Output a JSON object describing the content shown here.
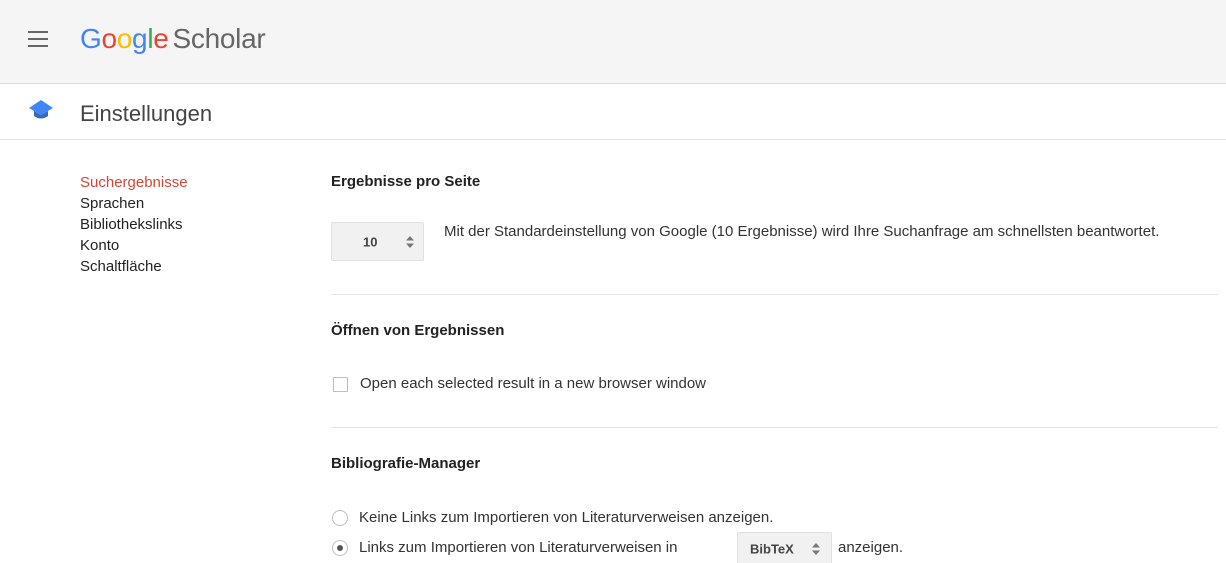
{
  "header": {
    "logo": {
      "letters": [
        {
          "char": "G",
          "color": "#4285F4"
        },
        {
          "char": "o",
          "color": "#EA4335"
        },
        {
          "char": "o",
          "color": "#FBBC05"
        },
        {
          "char": "g",
          "color": "#4285F4"
        },
        {
          "char": "l",
          "color": "#34A853"
        },
        {
          "char": "e",
          "color": "#EA4335"
        }
      ],
      "product": "Scholar"
    },
    "menu_icon": "hamburger-menu-icon"
  },
  "titlebar": {
    "icon": "graduation-cap-icon",
    "title": "Einstellungen"
  },
  "sidenav": {
    "items": [
      {
        "label": "Suchergebnisse",
        "active": true
      },
      {
        "label": "Sprachen",
        "active": false
      },
      {
        "label": "Bibliothekslinks",
        "active": false
      },
      {
        "label": "Konto",
        "active": false
      },
      {
        "label": "Schaltfläche",
        "active": false
      }
    ]
  },
  "results_per_page": {
    "title": "Ergebnisse pro Seite",
    "selected": "10",
    "hint": "Mit der Standardeinstellung von Google (10 Ergebnisse) wird Ihre Suchanfrage am schnellsten beantwortet."
  },
  "open_results": {
    "title": "Öffnen von Ergebnissen",
    "checkbox_label": "Open each selected result in a new browser window",
    "checked": false
  },
  "bib_manager": {
    "title": "Bibliografie-Manager",
    "option_none": "Keine Links zum Importieren von Literaturverweisen anzeigen.",
    "option_show_prefix": "Links zum Importieren von Literaturverweisen in",
    "format_selected": "BibTeX",
    "option_show_suffix": "anzeigen.",
    "selected_option": "show"
  },
  "colors": {
    "active_nav": "#d14836",
    "header_bg": "#f5f5f5",
    "cap_icon": "#4285F4"
  }
}
